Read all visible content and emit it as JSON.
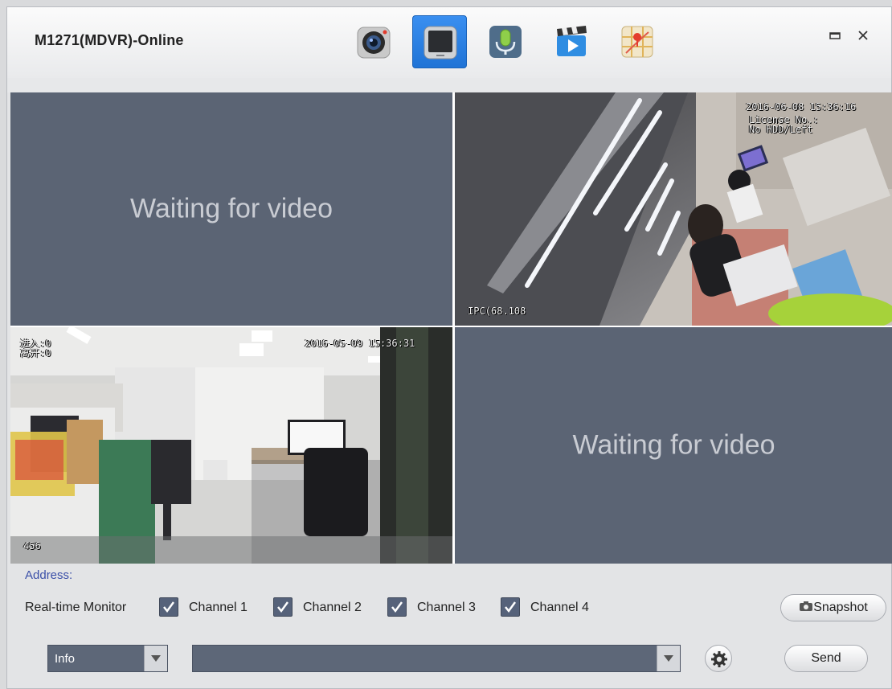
{
  "window": {
    "title": "M1271(MDVR)-Online",
    "minimize_icon": "minimize-icon",
    "close_icon": "close-icon"
  },
  "toolbar": [
    {
      "name": "camera-snapshot",
      "icon": "camera-icon",
      "active": false
    },
    {
      "name": "video-monitor",
      "icon": "monitor-icon",
      "active": true
    },
    {
      "name": "intercom",
      "icon": "microphone-icon",
      "active": false
    },
    {
      "name": "playback",
      "icon": "clapperboard-icon",
      "active": false
    },
    {
      "name": "map",
      "icon": "map-icon",
      "active": false
    }
  ],
  "video": {
    "tiles": [
      {
        "channel": 1,
        "state": "waiting",
        "message": "Waiting for video"
      },
      {
        "channel": 2,
        "state": "live",
        "timestamp": "2016-06-08 15:36:16",
        "info_line1": "License No.:",
        "info_line2": "No HDD/Left",
        "camera_name": "IPC(68.108"
      },
      {
        "channel": 3,
        "state": "live",
        "timestamp": "2016-05-09 15:36:31",
        "counter_in": "进入:0",
        "counter_out": "离开:0",
        "camera_name": "456"
      },
      {
        "channel": 4,
        "state": "waiting",
        "message": "Waiting for video"
      }
    ]
  },
  "controls": {
    "address_label": "Address:",
    "realtime_label": "Real-time Monitor",
    "channels": [
      {
        "label": "Channel 1",
        "checked": true
      },
      {
        "label": "Channel 2",
        "checked": true
      },
      {
        "label": "Channel 3",
        "checked": true
      },
      {
        "label": "Channel 4",
        "checked": true
      }
    ],
    "snapshot_label": "Snapshot",
    "type_select_value": "Info",
    "message_select_value": "",
    "send_label": "Send"
  },
  "colors": {
    "accent": "#2a7de1",
    "tile_bg": "#5b6474",
    "address_text": "#3a4fa8"
  }
}
